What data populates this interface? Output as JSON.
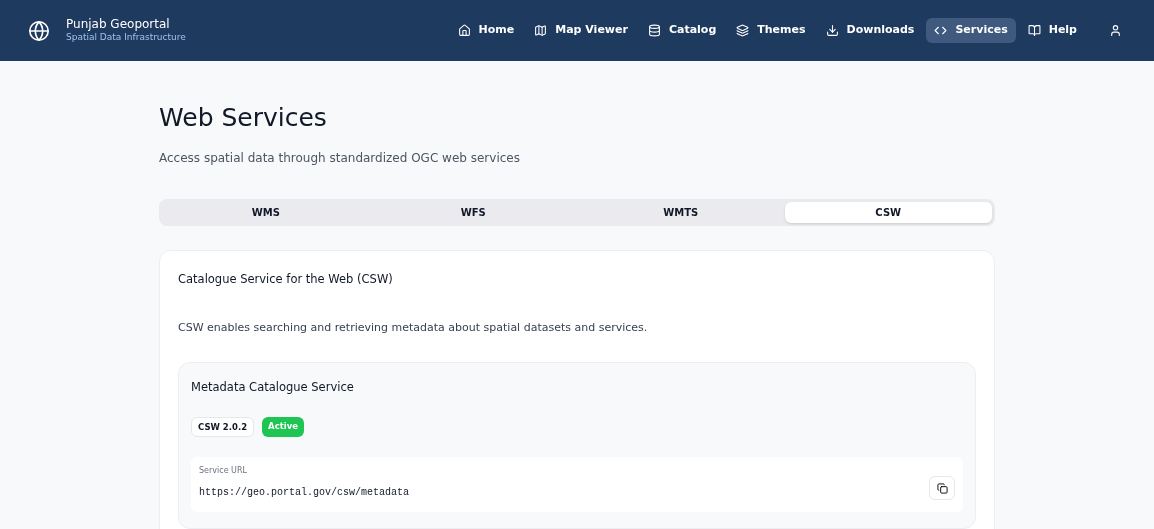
{
  "brand": {
    "title": "Punjab Geoportal",
    "subtitle": "Spatial Data Infrastructure"
  },
  "nav": [
    {
      "label": "Home",
      "selected": false
    },
    {
      "label": "Map Viewer",
      "selected": false
    },
    {
      "label": "Catalog",
      "selected": false
    },
    {
      "label": "Themes",
      "selected": false
    },
    {
      "label": "Downloads",
      "selected": false
    },
    {
      "label": "Services",
      "selected": true
    },
    {
      "label": "Help",
      "selected": false
    }
  ],
  "page": {
    "title": "Web Services",
    "subtitle": "Access spatial data through standardized OGC web services"
  },
  "tabs": [
    {
      "label": "WMS",
      "selected": false
    },
    {
      "label": "WFS",
      "selected": false
    },
    {
      "label": "WMTS",
      "selected": false
    },
    {
      "label": "CSW",
      "selected": true
    }
  ],
  "panel": {
    "title": "Catalogue Service for the Web (CSW)",
    "description": "CSW enables searching and retrieving metadata about spatial datasets and services.",
    "service": {
      "title": "Metadata Catalogue Service",
      "badges": [
        {
          "label": "CSW 2.0.2",
          "kind": "version"
        },
        {
          "label": "Active",
          "kind": "status"
        }
      ],
      "url_label": "Service URL",
      "url": "https://geo.portal.gov/csw/metadata"
    }
  }
}
